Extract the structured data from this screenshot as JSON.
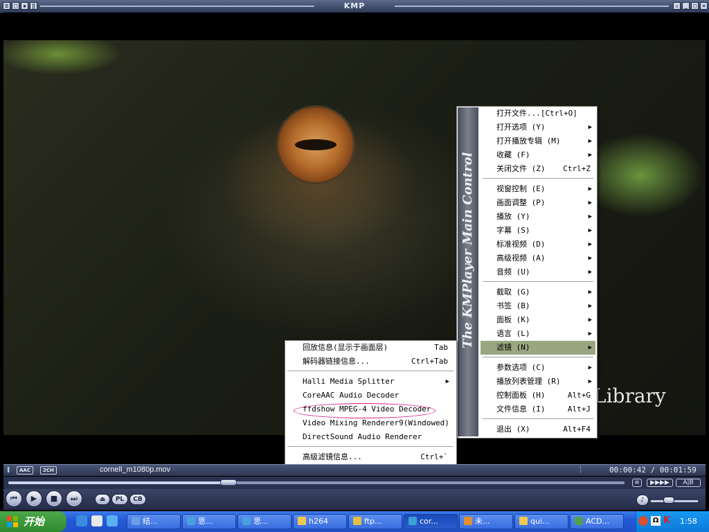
{
  "window": {
    "title": "KMP"
  },
  "video": {
    "caption": "Library"
  },
  "status": {
    "badges": [
      "AAC",
      "2CH"
    ],
    "filename": "cornell_m1080p.mov",
    "time_current": "00:00:42",
    "time_separator": "/",
    "time_total": "00:01:59"
  },
  "seek": {
    "progress_fraction": 0.353
  },
  "controls": {
    "pl_label": "PL",
    "cb_label": "CB",
    "ab_label": "A|B"
  },
  "main_menu": {
    "sidebar_text": "The KMPlayer  Main Control",
    "items": [
      {
        "label": "打开文件...[Ctrl+O]",
        "shortcut": "",
        "submenu": false
      },
      {
        "label": "打开选项 (Y)",
        "shortcut": "",
        "submenu": true
      },
      {
        "label": "打开播放专辑 (M)",
        "shortcut": "",
        "submenu": true
      },
      {
        "label": "收藏 (F)",
        "shortcut": "",
        "submenu": true
      },
      {
        "label": "关闭文件 (Z)",
        "shortcut": "Ctrl+Z",
        "submenu": false
      },
      {
        "label": "视窗控制 (E)",
        "shortcut": "",
        "submenu": true
      },
      {
        "label": "画面调整 (P)",
        "shortcut": "",
        "submenu": true
      },
      {
        "label": "播放 (Y)",
        "shortcut": "",
        "submenu": true
      },
      {
        "label": "字幕 (S)",
        "shortcut": "",
        "submenu": true
      },
      {
        "label": "标准视频 (D)",
        "shortcut": "",
        "submenu": true
      },
      {
        "label": "高级视频 (A)",
        "shortcut": "",
        "submenu": true
      },
      {
        "label": "音频 (U)",
        "shortcut": "",
        "submenu": true
      },
      {
        "label": "截取 (G)",
        "shortcut": "",
        "submenu": true
      },
      {
        "label": "书签 (B)",
        "shortcut": "",
        "submenu": true
      },
      {
        "label": "面板 (K)",
        "shortcut": "",
        "submenu": true
      },
      {
        "label": "语言 (L)",
        "shortcut": "",
        "submenu": true
      },
      {
        "label": "滤镜 (N)",
        "shortcut": "",
        "submenu": true
      },
      {
        "label": "参数选项 (C)",
        "shortcut": "",
        "submenu": true
      },
      {
        "label": "播放列表管理 (R)",
        "shortcut": "",
        "submenu": true
      },
      {
        "label": "控制面板 (H)",
        "shortcut": "Alt+G",
        "submenu": false
      },
      {
        "label": "文件信息 (I)",
        "shortcut": "Alt+J",
        "submenu": false
      },
      {
        "label": "退出 (X)",
        "shortcut": "Alt+F4",
        "submenu": false
      }
    ]
  },
  "filter_menu": {
    "items": [
      {
        "label": "回放信息(显示于画面层)",
        "shortcut": "Tab",
        "submenu": false
      },
      {
        "label": "解码器链接信息...",
        "shortcut": "Ctrl+Tab",
        "submenu": false
      },
      {
        "label": "Halli Media Splitter",
        "shortcut": "",
        "submenu": true
      },
      {
        "label": "CoreAAC Audio Decoder",
        "shortcut": "",
        "submenu": false
      },
      {
        "label": "ffdshow MPEG-4 Video Decoder",
        "shortcut": "",
        "submenu": false
      },
      {
        "label": "Video Mixing Renderer9(Windowed)",
        "shortcut": "",
        "submenu": false
      },
      {
        "label": "DirectSound Audio Renderer",
        "shortcut": "",
        "submenu": false
      },
      {
        "label": "高级滤镜信息...",
        "shortcut": "Ctrl+`",
        "submenu": false
      }
    ]
  },
  "taskbar": {
    "start_label": "开始",
    "tasks": [
      {
        "label": "结...",
        "icon_color": "#6aa0e8"
      },
      {
        "label": "思...",
        "icon_color": "#4aa0e0"
      },
      {
        "label": "思...",
        "icon_color": "#4aa0e0"
      },
      {
        "label": "h264",
        "icon_color": "#f0c850"
      },
      {
        "label": "ftp...",
        "icon_color": "#e0c040"
      },
      {
        "label": "cor...",
        "icon_color": "#3aa0d8"
      },
      {
        "label": "未...",
        "icon_color": "#e09030"
      },
      {
        "label": "qui...",
        "icon_color": "#f0c850"
      },
      {
        "label": "ACD...",
        "icon_color": "#50a050"
      }
    ],
    "clock": "1:58"
  }
}
